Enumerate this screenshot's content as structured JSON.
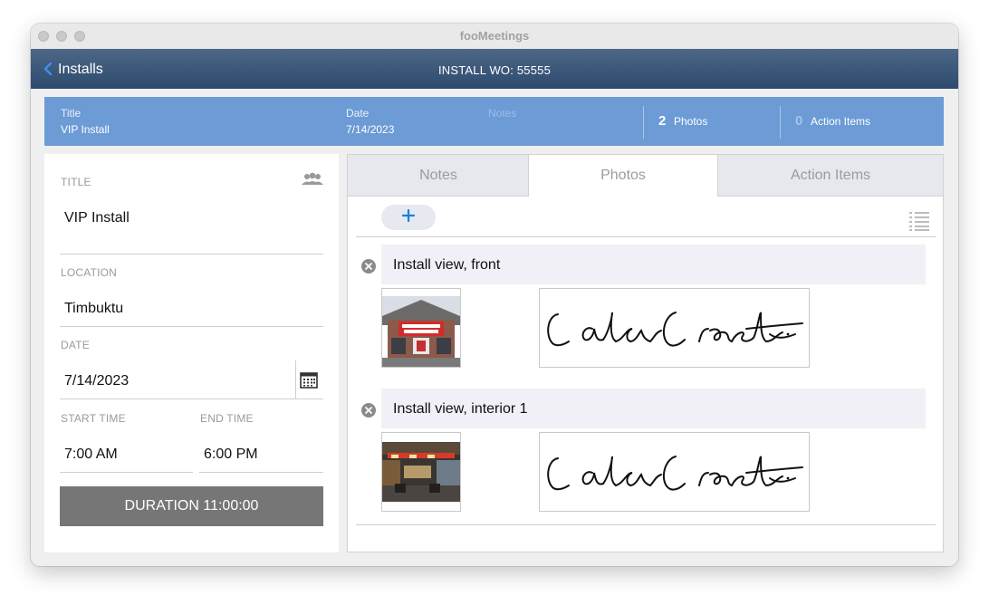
{
  "window": {
    "title": "fooMeetings"
  },
  "nav": {
    "back_label": "Installs",
    "title": "INSTALL WO:  55555"
  },
  "summary": {
    "title_label": "Title",
    "title_value": "VIP Install",
    "date_label": "Date",
    "date_value": "7/14/2023",
    "notes_label": "Notes",
    "photos_count": "2",
    "photos_label": "Photos",
    "action_count": "0",
    "action_label": "Action Items"
  },
  "form": {
    "title_label": "TITLE",
    "title_value": "VIP Install",
    "location_label": "LOCATION",
    "location_value": "Timbuktu",
    "date_label": "DATE",
    "date_value": "7/14/2023",
    "start_label": "START TIME",
    "start_value": "7:00 AM",
    "end_label": "END TIME",
    "end_value": "6:00 PM",
    "duration_label": "DURATION 11:00:00"
  },
  "tabs": [
    {
      "label": "Notes"
    },
    {
      "label": "Photos"
    },
    {
      "label": "Action Items"
    }
  ],
  "active_tab": "Photos",
  "photos": [
    {
      "caption": "Install view, front"
    },
    {
      "caption": "Install view, interior 1"
    }
  ],
  "colors": {
    "nav_bar": "#2e4a6d",
    "summary_bar": "#6c9bd6",
    "accent_blue": "#1a7fe0",
    "duration_button": "#767676"
  },
  "icons": [
    "back-chevron-icon",
    "group-icon",
    "calendar-icon",
    "plus-icon",
    "list-icon",
    "delete-icon"
  ]
}
